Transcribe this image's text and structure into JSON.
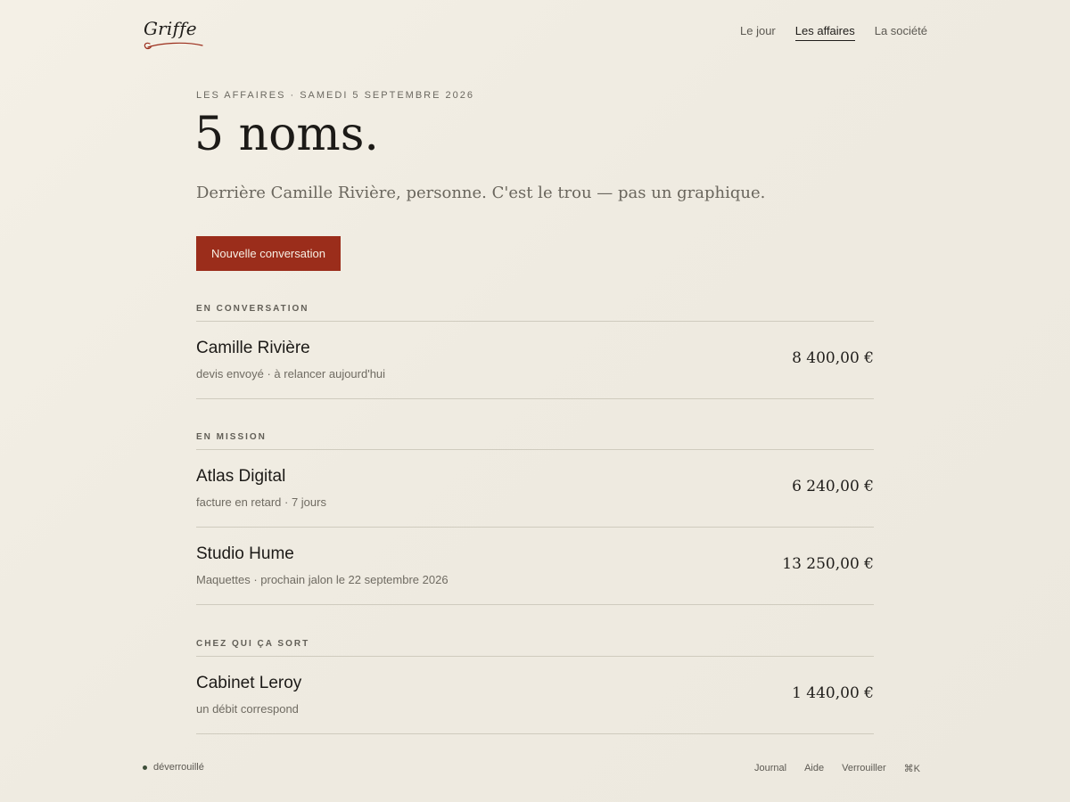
{
  "brand": {
    "name": "Griffe",
    "accent": "#9b2d1b"
  },
  "nav": {
    "items": [
      {
        "label": "Le jour",
        "active": false
      },
      {
        "label": "Les affaires",
        "active": true
      },
      {
        "label": "La société",
        "active": false
      }
    ]
  },
  "header": {
    "kicker": "LES AFFAIRES · SAMEDI 5 SEPTEMBRE 2026",
    "title": "5 noms.",
    "subtitle": "Derrière Camille Rivière, personne. C'est le trou — pas un graphique."
  },
  "cta": {
    "label": "Nouvelle conversation"
  },
  "sections": [
    {
      "label": "EN CONVERSATION",
      "rows": [
        {
          "name": "Camille Rivière",
          "note": "devis envoyé · à relancer aujourd'hui",
          "amount": "8 400,00 €"
        }
      ]
    },
    {
      "label": "EN MISSION",
      "rows": [
        {
          "name": "Atlas Digital",
          "note": "facture en retard · 7 jours",
          "amount": "6 240,00 €"
        },
        {
          "name": "Studio Hume",
          "note": "Maquettes · prochain jalon le 22 septembre 2026",
          "amount": "13 250,00 €"
        }
      ]
    },
    {
      "label": "CHEZ QUI ÇA SORT",
      "rows": [
        {
          "name": "Cabinet Leroy",
          "note": "un débit correspond",
          "amount": "1 440,00 €"
        }
      ]
    }
  ],
  "footer": {
    "status": "déverrouillé",
    "status_color": "#3e4f3a",
    "links": [
      "Journal",
      "Aide",
      "Verrouiller",
      "⌘K"
    ]
  }
}
